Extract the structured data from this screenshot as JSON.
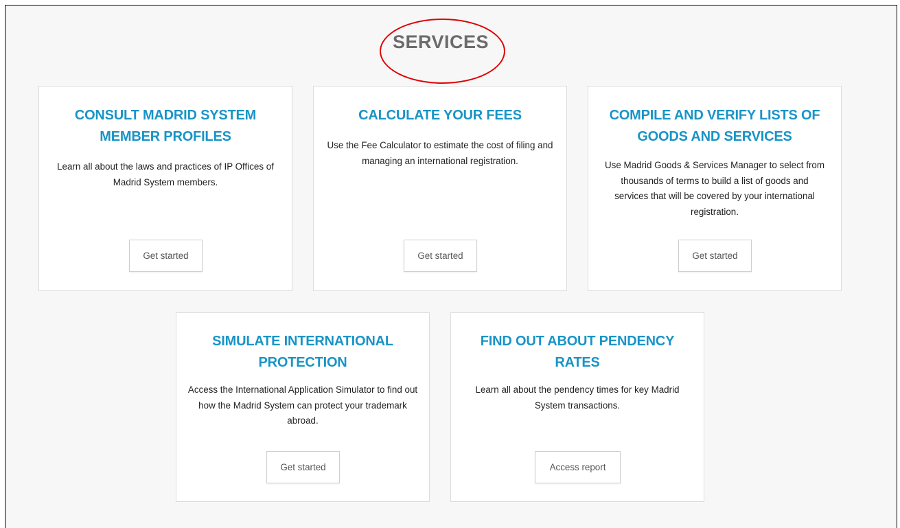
{
  "page": {
    "heading": "SERVICES"
  },
  "cards": [
    {
      "title": "CONSULT MADRID SYSTEM MEMBER PROFILES",
      "description": "Learn all about the laws and practices of IP Offices of Madrid System members.",
      "button": "Get started"
    },
    {
      "title": "CALCULATE YOUR FEES",
      "description": "Use the Fee Calculator to estimate the cost of filing and managing an international registration.",
      "button": "Get started"
    },
    {
      "title": "COMPILE AND VERIFY LISTS OF GOODS AND SERVICES",
      "description": "Use Madrid Goods & Services Manager to select from thousands of terms to build a list of goods and services that will be covered by your international registration.",
      "button": "Get started"
    },
    {
      "title": "SIMULATE INTERNATIONAL PROTECTION",
      "description": "Access the International Application Simulator to find out how the Madrid System can protect your trademark abroad.",
      "button": "Get started"
    },
    {
      "title": "FIND OUT ABOUT PENDENCY RATES",
      "description": "Learn all about the pendency times for key Madrid System transactions.",
      "button": "Access report"
    }
  ],
  "colors": {
    "title_blue": "#1994c6",
    "heading_gray": "#6b6b6b",
    "annotation_red": "#e00000"
  }
}
